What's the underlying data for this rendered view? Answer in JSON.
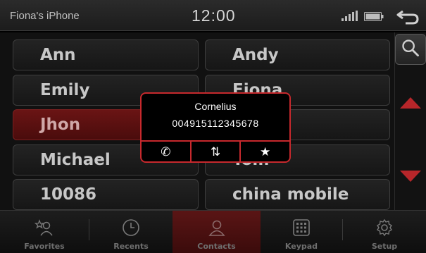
{
  "status_bar": {
    "device_name": "Fiona's iPhone",
    "time": "12:00",
    "icons": [
      "signal-icon",
      "battery-icon",
      "back-arrow-icon"
    ]
  },
  "contacts": [
    {
      "name": "Ann",
      "selected": false
    },
    {
      "name": "Andy",
      "selected": false
    },
    {
      "name": "Emily",
      "selected": false
    },
    {
      "name": "Fiona",
      "selected": false
    },
    {
      "name": "Jhon",
      "selected": true
    },
    {
      "name": "",
      "selected": false
    },
    {
      "name": "Michael",
      "selected": false
    },
    {
      "name": "Tom",
      "selected": false
    },
    {
      "name": "10086",
      "selected": false
    },
    {
      "name": "china mobile",
      "selected": false
    }
  ],
  "side_controls": {
    "icons": [
      "search-icon",
      "scroll-up-icon",
      "scroll-down-icon"
    ]
  },
  "popup": {
    "name": "Cornelius",
    "number": "004915112345678",
    "actions": [
      {
        "icon": "phone-icon",
        "glyph": "✆"
      },
      {
        "icon": "transfer-icon",
        "glyph": "⇅"
      },
      {
        "icon": "star-icon",
        "glyph": "★"
      }
    ]
  },
  "bottom_nav": {
    "items": [
      {
        "label": "Favorites",
        "icon": "favorites-icon",
        "active": false
      },
      {
        "label": "Recents",
        "icon": "clock-icon",
        "active": false
      },
      {
        "label": "Contacts",
        "icon": "contacts-icon",
        "active": true
      },
      {
        "label": "Keypad",
        "icon": "keypad-icon",
        "active": false
      },
      {
        "label": "Setup",
        "icon": "gear-icon",
        "active": false
      }
    ]
  },
  "colors": {
    "accent": "#c7292d",
    "selected_row": "#5a1212",
    "text": "#c7c7c7"
  }
}
